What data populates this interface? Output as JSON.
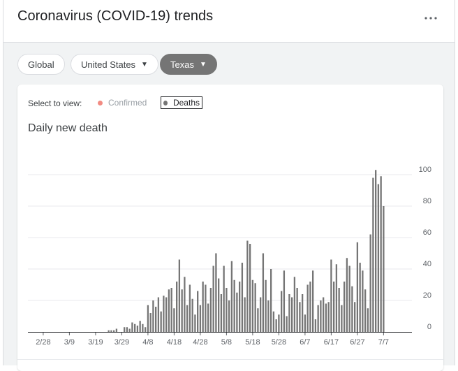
{
  "header": {
    "title": "Coronavirus (COVID-19) trends",
    "more_label": "⋮"
  },
  "filters": [
    {
      "label": "Global",
      "selected": false,
      "dropdown": false
    },
    {
      "label": "United States",
      "selected": false,
      "dropdown": true
    },
    {
      "label": "Texas",
      "selected": true,
      "dropdown": true
    }
  ],
  "view_select": {
    "label": "Select to view:",
    "options": [
      {
        "label": "Confirmed",
        "color": "#f28b82",
        "active": false
      },
      {
        "label": "Deaths",
        "color": "#757575",
        "active": true
      }
    ]
  },
  "colors": {
    "bar": "#757575",
    "grid": "#e8eaed",
    "axis": "#202124"
  },
  "chart_data": {
    "type": "bar",
    "title": "Daily new death",
    "xlabel": "",
    "ylabel": "",
    "ylim": [
      0,
      100
    ],
    "yticks": [
      0,
      20,
      40,
      60,
      80,
      100
    ],
    "x_tick_labels": [
      "2/28",
      "3/9",
      "3/19",
      "3/29",
      "4/8",
      "4/18",
      "4/28",
      "5/8",
      "5/18",
      "5/28",
      "6/7",
      "6/17",
      "6/27",
      "7/7"
    ],
    "x_tick_start_index": 5,
    "x_tick_step": 10,
    "grid": true,
    "series": [
      {
        "values": [
          0,
          0,
          0,
          0,
          0,
          0,
          0,
          0,
          0,
          0,
          0,
          0,
          0,
          0,
          0,
          0,
          0,
          0,
          0,
          0,
          0,
          0,
          0,
          0,
          0,
          0,
          0,
          0,
          0,
          0,
          1,
          1,
          1,
          2,
          0,
          0,
          3,
          3,
          2,
          6,
          5,
          4,
          7,
          5,
          3,
          17,
          12,
          20,
          16,
          22,
          13,
          23,
          22,
          27,
          28,
          15,
          32,
          46,
          27,
          35,
          17,
          30,
          21,
          11,
          26,
          17,
          32,
          30,
          18,
          28,
          42,
          50,
          34,
          24,
          42,
          28,
          20,
          45,
          33,
          25,
          32,
          44,
          22,
          58,
          56,
          33,
          31,
          15,
          22,
          50,
          33,
          20,
          40,
          13,
          8,
          11,
          26,
          39,
          10,
          24,
          22,
          35,
          28,
          19,
          24,
          11,
          30,
          32,
          39,
          8,
          17,
          20,
          22,
          18,
          19,
          46,
          32,
          43,
          28,
          17,
          32,
          47,
          42,
          29,
          19,
          57,
          44,
          39,
          27,
          15,
          62,
          98,
          103,
          94,
          99,
          80
        ]
      }
    ]
  }
}
